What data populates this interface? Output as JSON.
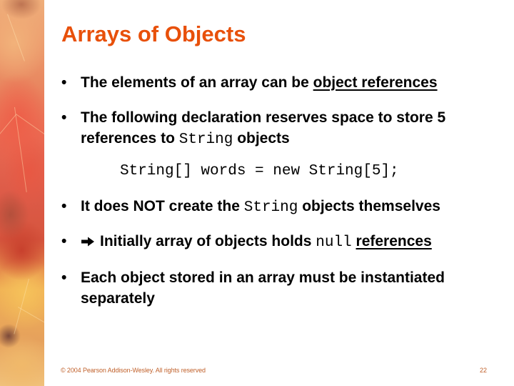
{
  "slide": {
    "title": "Arrays of Objects",
    "bullets": [
      {
        "marker": "•",
        "parts": {
          "a": "The elements of an array can be ",
          "b": "object references"
        }
      },
      {
        "marker": "•",
        "line1": "The following declaration reserves space to store 5",
        "line2_a": "references to ",
        "line2_code": "String",
        "line2_b": " objects"
      },
      {
        "marker": "•",
        "a": "It does NOT create the ",
        "code": "String",
        "b": " objects themselves"
      },
      {
        "marker": "•",
        "icon": "right-arrow-icon",
        "a": "Initially array of objects holds ",
        "code": "null",
        "b": " ",
        "c": "references"
      },
      {
        "marker": "•",
        "line1": "Each object stored in an array must be instantiated",
        "line2": "separately"
      }
    ],
    "code_example": "String[] words = new String[5];"
  },
  "footer": {
    "copyright": "© 2004 Pearson Addison-Wesley. All rights reserved",
    "page_number": "22"
  },
  "colors": {
    "title": "#e8500a",
    "text": "#000000",
    "footer": "#c0602a"
  }
}
